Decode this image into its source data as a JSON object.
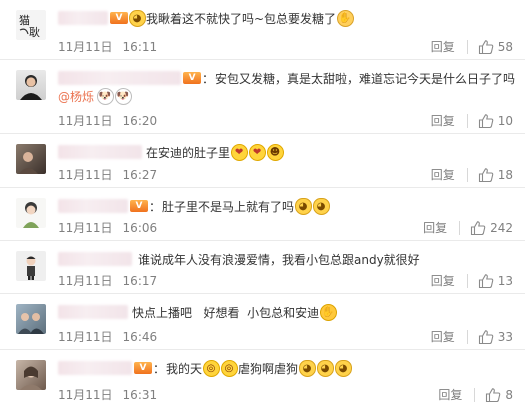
{
  "comments": [
    {
      "text": "我瞅着这不就快了吗~包总要发糖了",
      "emojis": [
        "cat",
        "pray"
      ],
      "date": "11月11日",
      "time": "16:11",
      "reply": "回复",
      "likes": "58"
    },
    {
      "text": "安包又发糖，真是太甜啦，难道忘记今天是什么日子了吗",
      "mention": "@杨烁",
      "mention_emojis": [
        "dog",
        "dog"
      ],
      "date": "11月11日",
      "time": "16:20",
      "reply": "回复",
      "likes": "10"
    },
    {
      "text": "在安迪的肚子里",
      "emojis": [
        "shy",
        "shy",
        "grin"
      ],
      "date": "11月11日",
      "time": "16:27",
      "reply": "回复",
      "likes": "18"
    },
    {
      "text": "肚子里不是马上就有了吗",
      "emojis": [
        "cat",
        "cat"
      ],
      "date": "11月11日",
      "time": "16:06",
      "reply": "回复",
      "likes": "242"
    },
    {
      "text": "谁说成年人没有浪漫爱情，我看小包总跟andy就很好",
      "emojis": [],
      "date": "11月11日",
      "time": "16:17",
      "reply": "回复",
      "likes": "13"
    },
    {
      "text": "快点上播吧   好想看  小包总和安迪",
      "emojis": [
        "hug"
      ],
      "date": "11月11日",
      "time": "16:46",
      "reply": "回复",
      "likes": "33"
    },
    {
      "text_a": "我的天",
      "text_b": "虐狗啊虐狗",
      "emojis_a": [
        "shock",
        "shock"
      ],
      "emojis_b": [
        "cat",
        "cat",
        "cat"
      ],
      "date": "11月11日",
      "time": "16:31",
      "reply": "回复",
      "likes": "8"
    }
  ]
}
